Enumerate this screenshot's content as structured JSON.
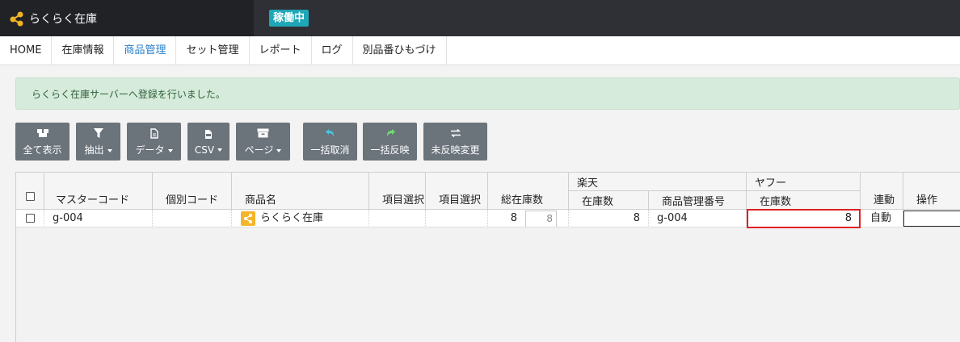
{
  "app": {
    "title": "らくらく在庫",
    "status": "稼働中"
  },
  "nav": {
    "items": [
      {
        "label": "HOME"
      },
      {
        "label": "在庫情報"
      },
      {
        "label": "商品管理",
        "active": true
      },
      {
        "label": "セット管理"
      },
      {
        "label": "レポート"
      },
      {
        "label": "ログ"
      },
      {
        "label": "別品番ひもづけ"
      }
    ]
  },
  "alert": {
    "message": "らくらく在庫サーバーへ登録を行いました。"
  },
  "toolbar": {
    "show_all": "全て表示",
    "filter": "抽出",
    "data": "データ",
    "csv": "CSV",
    "page": "ページ",
    "bulk_cancel": "一括取消",
    "bulk_apply": "一括反映",
    "unapplied_changes": "未反映変更"
  },
  "table": {
    "headers": {
      "master_code": "マスターコード",
      "individual_code": "個別コード",
      "product_name": "商品名",
      "item_select_1": "項目選択",
      "item_select_2": "項目選択",
      "total_stock": "総在庫数",
      "rakuten": "楽天",
      "rakuten_stock": "在庫数",
      "rakuten_mgmt_no": "商品管理番号",
      "yahoo": "ヤフー",
      "yahoo_stock": "在庫数",
      "link": "連動",
      "action": "操作"
    },
    "rows": [
      {
        "master_code": "g-004",
        "individual_code": "",
        "product_name": "らくらく在庫",
        "item_select_1": "",
        "item_select_2": "",
        "total_stock": "8",
        "total_stock_input": "8",
        "rakuten_stock": "8",
        "rakuten_mgmt_no": "g-004",
        "yahoo_stock": "8",
        "link": "自動",
        "action": ""
      }
    ]
  },
  "colors": {
    "header_bg": "#2e3035",
    "brand_bg": "#202226",
    "status_badge": "#1fa6b7",
    "nav_active": "#2a7fc9",
    "alert_bg": "#d6ebdb",
    "alert_text": "#2f5f3a",
    "button_bg": "#6b737b",
    "undo_icon": "#45c6e0",
    "redo_icon": "#6fdc72",
    "highlight_border": "#e02020"
  },
  "icons": {
    "logo": "share-nodes-icon",
    "show_all": "boxes-icon",
    "filter": "funnel-icon",
    "data": "document-icon",
    "csv": "csv-file-icon",
    "page": "archive-box-icon",
    "bulk_cancel": "undo-arrow-icon",
    "bulk_apply": "redo-arrow-icon",
    "unapplied_changes": "swap-arrows-icon",
    "product": "product-logo-icon"
  }
}
